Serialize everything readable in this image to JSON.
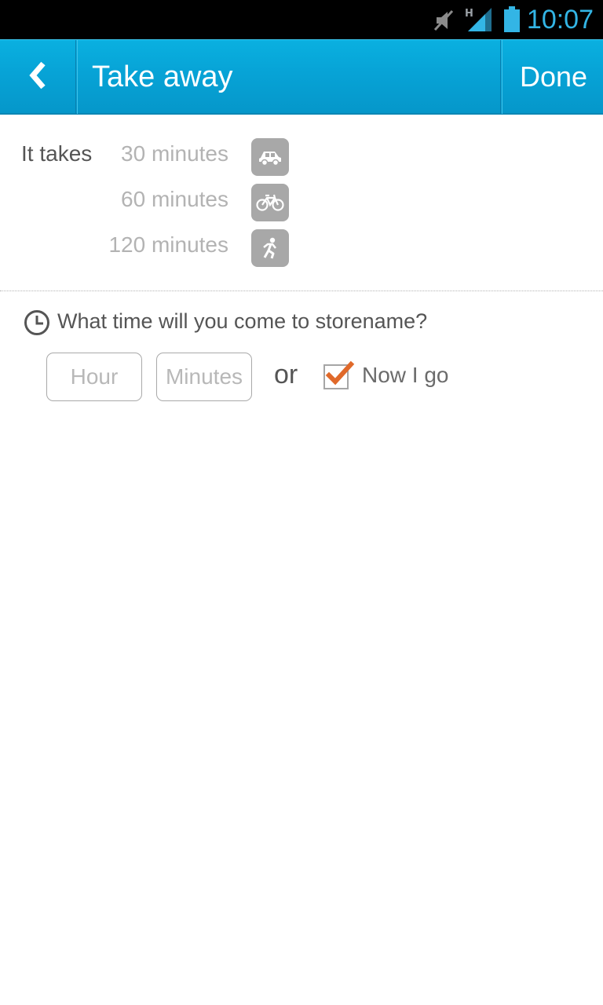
{
  "status_bar": {
    "time": "10:07",
    "icons": [
      "mute-icon",
      "signal-h-icon",
      "battery-icon"
    ],
    "accent": "#33b5e5"
  },
  "action_bar": {
    "title": "Take away",
    "done_label": "Done",
    "back_icon": "chevron-left-icon",
    "color": "#07a3d6"
  },
  "travel": {
    "label": "It takes",
    "modes": [
      {
        "minutes": "30 minutes",
        "icon": "car-icon"
      },
      {
        "minutes": "60 minutes",
        "icon": "bicycle-icon"
      },
      {
        "minutes": "120 minutes",
        "icon": "walking-icon"
      }
    ]
  },
  "arrival": {
    "question": "What time will you come to storename?",
    "hour_placeholder": "Hour",
    "minutes_placeholder": "Minutes",
    "or_label": "or",
    "now_label": "Now I go",
    "now_checked": true,
    "check_color": "#e0692a"
  }
}
